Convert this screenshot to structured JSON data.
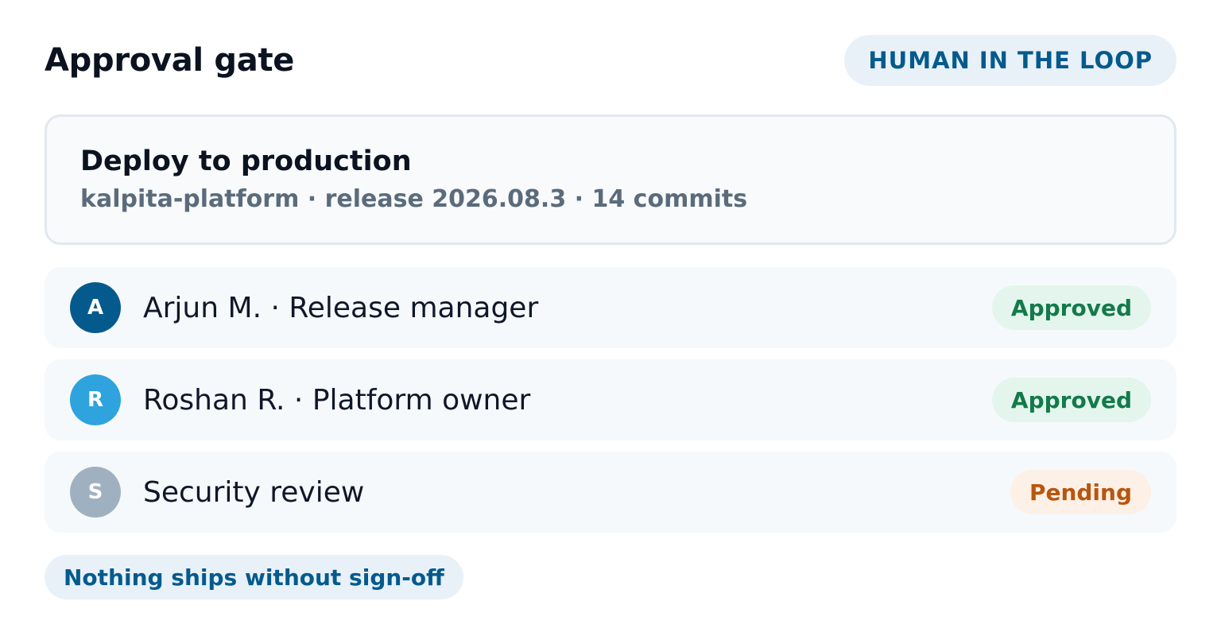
{
  "header": {
    "title": "Approval gate",
    "mode_pill": "HUMAN IN THE LOOP"
  },
  "deploy": {
    "title": "Deploy to production",
    "meta": "kalpita-platform · release 2026.08.3 · 14 commits"
  },
  "approvers": [
    {
      "initial": "A",
      "label": "Arjun M. · Release manager",
      "status": "Approved",
      "avatar_color": "#045a8d",
      "status_kind": "approved"
    },
    {
      "initial": "R",
      "label": "Roshan R. · Platform owner",
      "status": "Approved",
      "avatar_color": "#2ea3dd",
      "status_kind": "approved"
    },
    {
      "initial": "S",
      "label": "Security review",
      "status": "Pending",
      "avatar_color": "#9fb1c0",
      "status_kind": "pending"
    }
  ],
  "footer": {
    "note": "Nothing ships without sign-off"
  },
  "colors": {
    "accent": "#045a8d",
    "approved": "#137a4a",
    "pending": "#b8560f"
  }
}
